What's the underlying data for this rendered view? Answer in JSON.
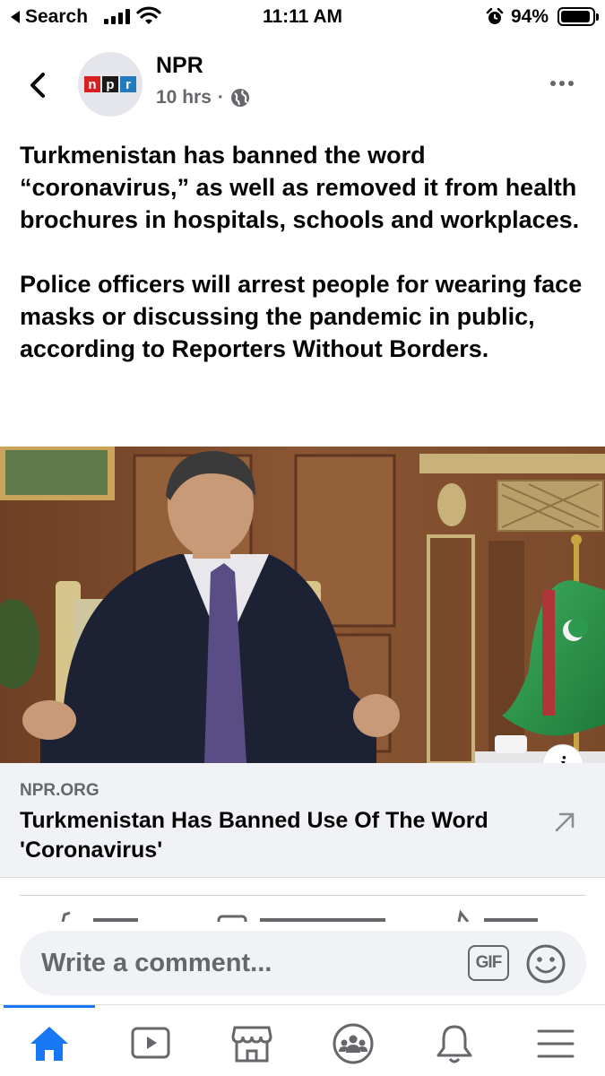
{
  "status_bar": {
    "back_label": "Search",
    "time": "11:11 AM",
    "battery_percent": "94%",
    "battery_level": 0.94,
    "icons": [
      "back-triangle-icon",
      "signal-icon",
      "wifi-icon",
      "alarm-icon",
      "battery-icon"
    ]
  },
  "post": {
    "page_name": "NPR",
    "avatar_logo": [
      "n",
      "p",
      "r"
    ],
    "time_ago": "10 hrs",
    "separator": "·",
    "audience_icon": "globe-icon",
    "paragraphs": [
      "Turkmenistan has banned the word “coronavirus,” as well as removed it from health brochures in hospitals, schools and workplaces.",
      "Police officers will arrest people for wearing face masks or discussing the pandemic in public, according to Reporters Without Borders."
    ]
  },
  "link_card": {
    "domain": "NPR.ORG",
    "title": "Turkmenistan Has Banned Use Of The Word 'Coronavirus'",
    "info_label": "i",
    "arrow_icon": "external-arrow-icon"
  },
  "comment_bar": {
    "placeholder": "Write a comment...",
    "gif_label": "GIF",
    "emoji_icon": "smiley-icon"
  },
  "tab_bar": {
    "active": "home",
    "tabs": [
      "home-icon",
      "watch-icon",
      "marketplace-icon",
      "groups-icon",
      "notifications-icon",
      "menu-icon"
    ]
  },
  "colors": {
    "accent": "#1877f2",
    "secondary_text": "#65676b",
    "card_bg": "#f0f2f5",
    "npr_red": "#d62021",
    "npr_black": "#1a1a1a",
    "npr_blue": "#237bbd",
    "flag_green": "#2e9a4f"
  }
}
